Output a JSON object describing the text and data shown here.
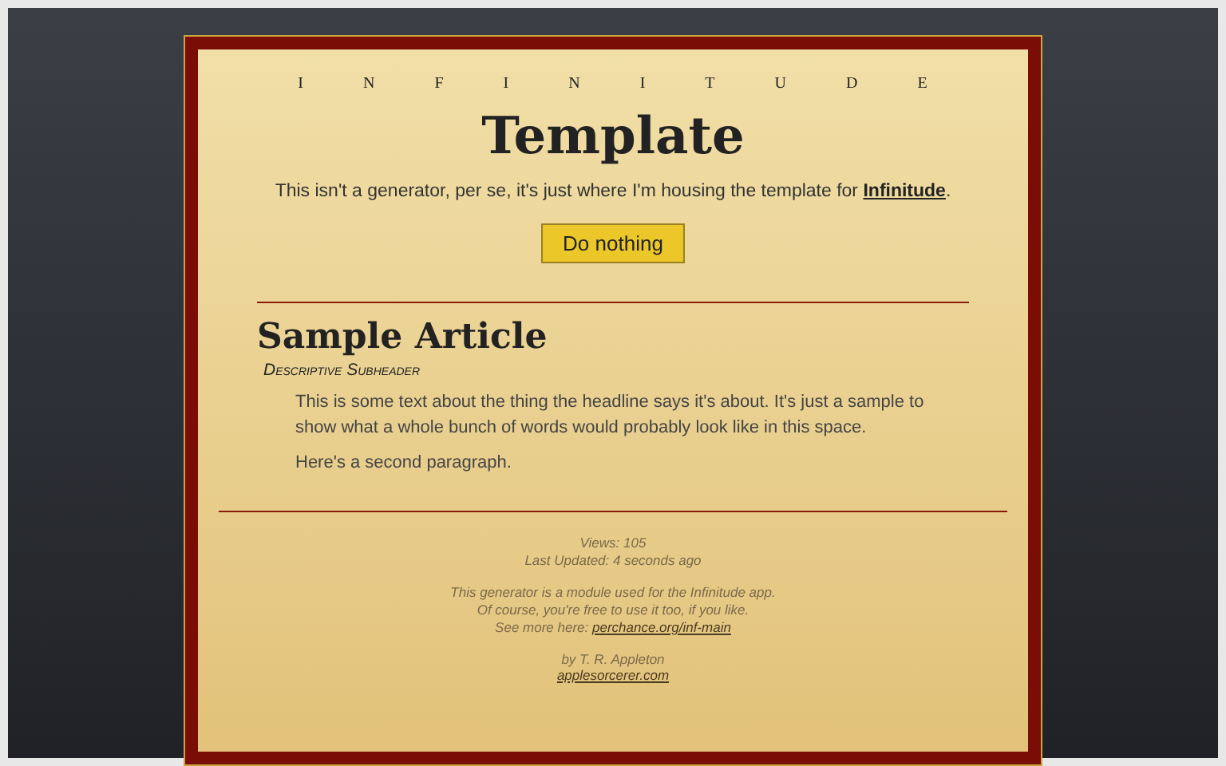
{
  "brand": "INFINITUDE",
  "title": "Template",
  "intro": {
    "text": "This isn't a generator, per se, it's just where I'm housing the template for ",
    "link": "Infinitude",
    "after": "."
  },
  "button": "Do nothing",
  "article": {
    "headline": "Sample Article",
    "subheader": "Descriptive Subheader",
    "paragraphs": [
      "This is some text about the thing the headline says it's about. It's just a sample to show what a whole bunch of words would probably look like in this space.",
      "Here's a second paragraph."
    ]
  },
  "footer": {
    "views": "Views: 105",
    "updated": "Last Updated: 4 seconds ago",
    "note": [
      "This generator is a module used for the Infinitude app.",
      "Of course, you're free to use it too, if you like."
    ],
    "more_label": "See more here: ",
    "more_link": "perchance.org/inf-main",
    "author": "by T. R. Appleton",
    "site": "applesorcerer.com"
  }
}
